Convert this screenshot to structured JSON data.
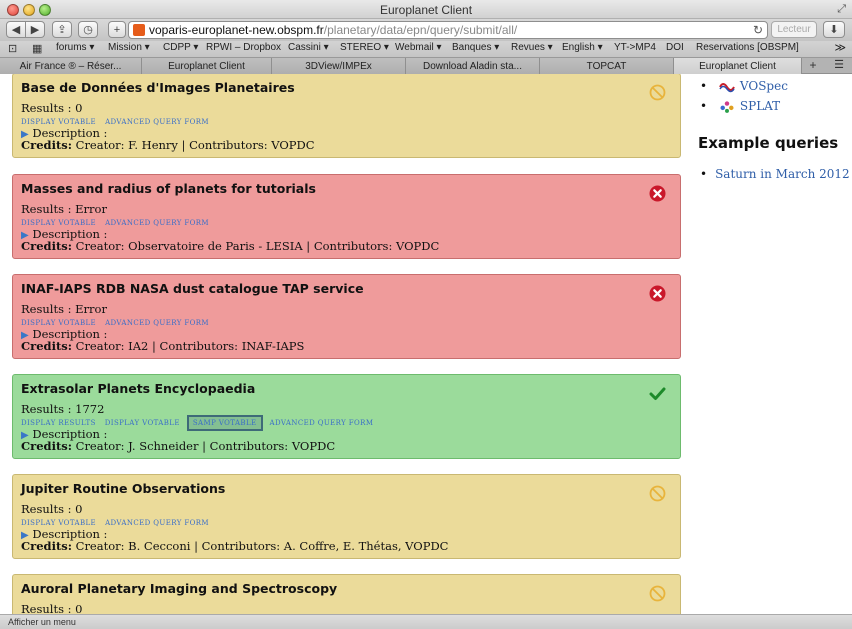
{
  "window": {
    "title": "Europlanet Client"
  },
  "toolbar": {
    "back_label": "◀",
    "forward_label": "▶",
    "url_host": "voparis-europlanet-new.obspm.fr",
    "url_path": "/planetary/data/epn/query/submit/all/",
    "reader_label": "Lecteur"
  },
  "bookmarks": [
    "forums ▾",
    "Mission ▾",
    "CDPP ▾",
    "RPWI – Dropbox",
    "Cassini ▾",
    "STEREO ▾",
    "Webmail ▾",
    "Banques ▾",
    "Revues ▾",
    "English ▾",
    "YT->MP4",
    "DOI",
    "Reservations [OBSPM]"
  ],
  "tabs": [
    {
      "label": "Air France ® – Réser...",
      "active": false
    },
    {
      "label": "Europlanet Client",
      "active": false
    },
    {
      "label": "3DView/IMPEx",
      "active": false
    },
    {
      "label": "Download Aladin sta...",
      "active": false
    },
    {
      "label": "TOPCAT",
      "active": false
    },
    {
      "label": "Europlanet Client",
      "active": true
    }
  ],
  "services": [
    {
      "title": "Base de Données d'Images Planetaires",
      "results": "Results : 0",
      "status": "pending",
      "links": [
        "DISPLAY VOTABLE",
        "ADVANCED QUERY FORM"
      ],
      "description": "Description :",
      "credits_label": "Credits:",
      "credits": "Creator: F. Henry | Contributors: VOPDC"
    },
    {
      "title": "Masses and radius of planets for tutorials",
      "results": "Results : Error",
      "status": "error",
      "links": [
        "DISPLAY VOTABLE",
        "ADVANCED QUERY FORM"
      ],
      "description": "Description :",
      "credits_label": "Credits:",
      "credits": "Creator: Observatoire de Paris - LESIA | Contributors: VOPDC"
    },
    {
      "title": "INAF-IAPS RDB NASA dust catalogue TAP service",
      "results": "Results : Error",
      "status": "error",
      "links": [
        "DISPLAY VOTABLE",
        "ADVANCED QUERY FORM"
      ],
      "description": "Description :",
      "credits_label": "Credits:",
      "credits": "Creator: IA2 | Contributors: INAF-IAPS"
    },
    {
      "title": "Extrasolar Planets Encyclopaedia",
      "results": "Results : 1772",
      "status": "success",
      "links": [
        "DISPLAY RESULTS",
        "DISPLAY VOTABLE",
        "SAMP VOTABLE",
        "ADVANCED QUERY FORM"
      ],
      "description": "Description :",
      "credits_label": "Credits:",
      "credits": "Creator: J. Schneider | Contributors: VOPDC"
    },
    {
      "title": "Jupiter Routine Observations",
      "results": "Results : 0",
      "status": "pending",
      "links": [
        "DISPLAY VOTABLE",
        "ADVANCED QUERY FORM"
      ],
      "description": "Description :",
      "credits_label": "Credits:",
      "credits": "Creator: B. Cecconi | Contributors: A. Coffre, E. Thétas, VOPDC"
    },
    {
      "title": "Auroral Planetary Imaging and Spectroscopy",
      "results": "Results : 0",
      "status": "pending",
      "links": [],
      "description": "",
      "credits_label": "",
      "credits": ""
    }
  ],
  "sidebar": {
    "tools": [
      {
        "label": "VOSpec",
        "icon": "vospec-logo-icon"
      },
      {
        "label": "SPLAT",
        "icon": "splat-logo-icon"
      }
    ],
    "examples_heading": "Example queries",
    "examples": [
      "Saturn in March 2012"
    ]
  },
  "statusbar": {
    "text": "Afficher un menu"
  },
  "colors": {
    "pending": "#ebdb9a",
    "error": "#ef9b9b",
    "success": "#9bdb9b",
    "link": "#2f5ea8"
  }
}
